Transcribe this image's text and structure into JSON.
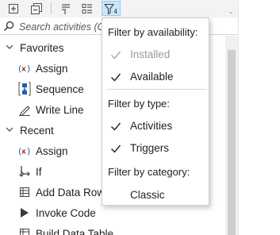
{
  "search": {
    "placeholder": "Search activities (Ctrl+Alt+F)"
  },
  "toolbar": {
    "buttons": [
      "expand-all-icon",
      "collapse-all-icon",
      "show-properties-icon",
      "show-list-icon",
      "filter-icon"
    ],
    "filter_badge": "4"
  },
  "tree": {
    "groups": [
      {
        "label": "Favorites",
        "items": [
          {
            "label": "Assign",
            "icon": "assign-icon"
          },
          {
            "label": "Sequence",
            "icon": "sequence-icon"
          },
          {
            "label": "Write Line",
            "icon": "write-line-icon"
          }
        ]
      },
      {
        "label": "Recent",
        "items": [
          {
            "label": "Assign",
            "icon": "assign-icon"
          },
          {
            "label": "If",
            "icon": "if-icon"
          },
          {
            "label": "Add Data Row",
            "icon": "add-data-row-icon"
          },
          {
            "label": "Invoke Code",
            "icon": "invoke-code-icon"
          },
          {
            "label": "Build Data Table",
            "icon": "build-data-table-icon"
          }
        ]
      }
    ]
  },
  "filter_menu": {
    "availability_header": "Filter by availability:",
    "availability": [
      {
        "label": "Installed",
        "checked": true,
        "enabled": false
      },
      {
        "label": "Available",
        "checked": true,
        "enabled": true
      }
    ],
    "type_header": "Filter by type:",
    "types": [
      {
        "label": "Activities",
        "checked": true
      },
      {
        "label": "Triggers",
        "checked": true
      }
    ],
    "category_header": "Filter by category:",
    "categories": [
      {
        "label": "Classic",
        "checked": false
      }
    ]
  },
  "colors": {
    "accent": "#0067c0",
    "assign_red": "#c42b1c",
    "sequence_blue": "#1e5fb4",
    "filter_active_bg": "#cde5f7"
  }
}
